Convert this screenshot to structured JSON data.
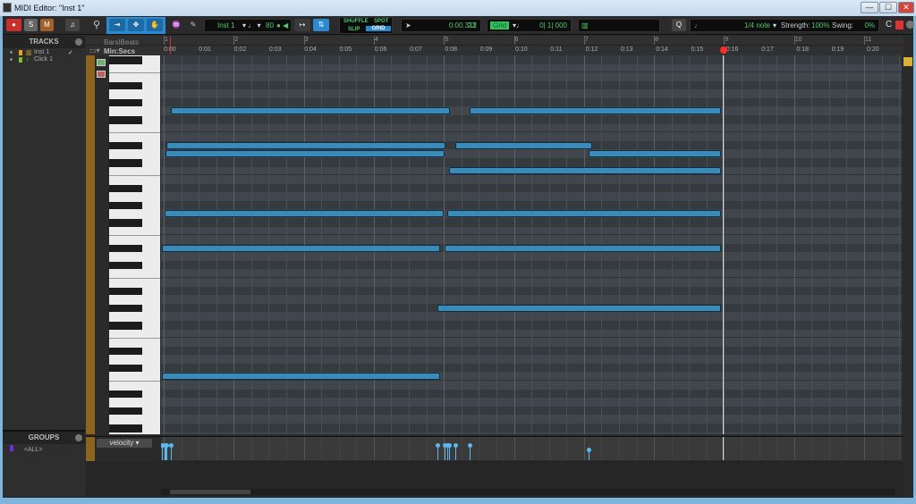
{
  "window": {
    "title": "MIDI Editor: \"Inst 1\"",
    "minimize": "—",
    "maximize": "☐",
    "close": "✕"
  },
  "toolbar": {
    "record": "●",
    "solo": "S",
    "mute": "M",
    "track_name": "Inst 1",
    "tempo": "80",
    "shuffle": "SHUFFLE",
    "spot": "SPOT",
    "slip": "SLIP",
    "grid_mode": "GRID",
    "counter": "0:00.312",
    "counter2": "23",
    "grid_label": "Grid",
    "grid_value": "0| 1| 000",
    "quantize_note": "1/4 note",
    "strength_label": "Strength:",
    "strength": "100%",
    "swing_label": "Swing:",
    "swing": "0%"
  },
  "tracks": {
    "header": "TRACKS",
    "items": [
      {
        "name": "Inst 1",
        "color": "#e8a020",
        "check": "✓"
      },
      {
        "name": "Click 1",
        "color": "#7ac02a"
      }
    ]
  },
  "groups": {
    "header": "GROUPS",
    "items": [
      {
        "name": "<ALL>",
        "color": "#6a2de0"
      }
    ]
  },
  "ruler": {
    "bars_label": "Bars|Beats",
    "secs_label": "Min:Secs",
    "bars": [
      "1",
      "2",
      "3",
      "4",
      "5",
      "6",
      "7",
      "8",
      "9",
      "10",
      "11"
    ],
    "secs": [
      "0:00",
      "0:01",
      "0:02",
      "0:03",
      "0:04",
      "0:05",
      "0:06",
      "0:07",
      "0:08",
      "0:09",
      "0:10",
      "0:11",
      "0:12",
      "0:13",
      "0:14",
      "0:15",
      "0:16",
      "0:17",
      "0:18",
      "0:19",
      "0:20"
    ]
  },
  "velocity_lane": {
    "label": "velocity"
  },
  "colors": {
    "note": "#3b8ab8",
    "playhead": "#ff2a2a",
    "velocity": "#5ab8f0"
  },
  "chart_data": {
    "type": "piano-roll",
    "playhead_bar": 9,
    "notes": [
      {
        "pitch": 91,
        "start": 1.1,
        "end": 5.09,
        "vel": 100
      },
      {
        "pitch": 91,
        "start": 5.37,
        "end": 8.96,
        "vel": 100
      },
      {
        "pitch": 87,
        "start": 1.04,
        "end": 5.02,
        "vel": 100
      },
      {
        "pitch": 87,
        "start": 5.16,
        "end": 7.12,
        "vel": 100
      },
      {
        "pitch": 86,
        "start": 1.03,
        "end": 5.01,
        "vel": 100
      },
      {
        "pitch": 86,
        "start": 7.07,
        "end": 8.96,
        "vel": 70
      },
      {
        "pitch": 84,
        "start": 5.07,
        "end": 8.96,
        "vel": 100
      },
      {
        "pitch": 79,
        "start": 1.01,
        "end": 5.0,
        "vel": 100
      },
      {
        "pitch": 79,
        "start": 5.05,
        "end": 8.96,
        "vel": 100
      },
      {
        "pitch": 75,
        "start": 0.98,
        "end": 4.95,
        "vel": 100
      },
      {
        "pitch": 75,
        "start": 5.01,
        "end": 8.96,
        "vel": 100
      },
      {
        "pitch": 68,
        "start": 4.91,
        "end": 8.96,
        "vel": 100
      },
      {
        "pitch": 60,
        "start": 0.98,
        "end": 4.95,
        "vel": 100
      }
    ]
  }
}
